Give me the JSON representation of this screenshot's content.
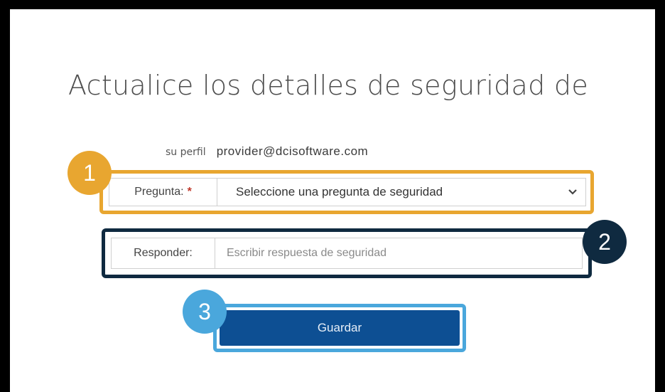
{
  "page": {
    "title": "Actualice los detalles de seguridad de",
    "profile_label": "su perfil",
    "profile_email": "provider@dcisoftware.com"
  },
  "question_field": {
    "label": "Pregunta:",
    "required_mark": "*",
    "selected_value": "Seleccione una pregunta de seguridad",
    "icon": "chevron-down-icon"
  },
  "answer_field": {
    "label": "Responder:",
    "placeholder": "Escribir respuesta de seguridad",
    "value": ""
  },
  "actions": {
    "save_label": "Guardar"
  },
  "callouts": [
    {
      "number": "1",
      "color": "#e8a630"
    },
    {
      "number": "2",
      "color": "#0f2a40"
    },
    {
      "number": "3",
      "color": "#4aa7dc"
    }
  ],
  "colors": {
    "frame": "#000000",
    "primary_button": "#0d4f93",
    "required": "#c0392b"
  }
}
